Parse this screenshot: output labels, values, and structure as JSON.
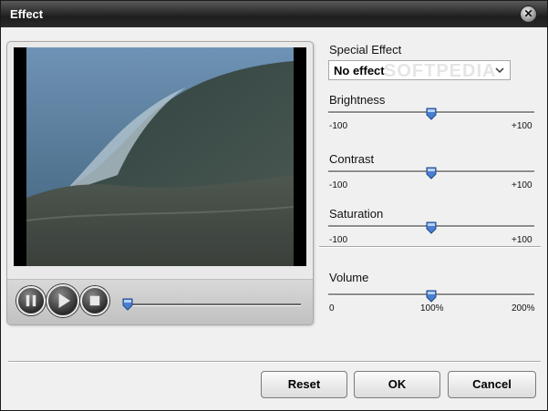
{
  "window": {
    "title": "Effect"
  },
  "watermark": "SOFTPEDIA",
  "icons": {
    "close": "close-icon",
    "pause": "pause-icon",
    "play": "play-icon",
    "stop": "stop-icon",
    "dropdown": "chevron-down-icon"
  },
  "colors": {
    "titlebar": "#2a2a2a",
    "slider_thumb": "#4a7fd0"
  },
  "playback": {
    "seek_position_fraction": 0.0
  },
  "effects": {
    "special_effect_label": "Special Effect",
    "special_effect_value": "No effect",
    "brightness": {
      "label": "Brightness",
      "min_label": "-100",
      "max_label": "+100",
      "value": 0
    },
    "contrast": {
      "label": "Contrast",
      "min_label": "-100",
      "max_label": "+100",
      "value": 0
    },
    "saturation": {
      "label": "Saturation",
      "min_label": "-100",
      "max_label": "+100",
      "value": 0
    },
    "volume": {
      "label": "Volume",
      "min_label": "0",
      "mid_label": "100%",
      "max_label": "200%",
      "value_percent": 100
    }
  },
  "buttons": {
    "reset": "Reset",
    "ok": "OK",
    "cancel": "Cancel"
  }
}
